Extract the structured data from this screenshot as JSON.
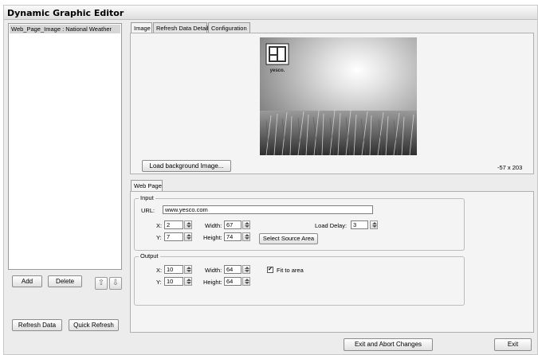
{
  "window": {
    "title": "Dynamic Graphic Editor"
  },
  "left_panel": {
    "list_items": [
      "Web_Page_Image : National Weather"
    ],
    "add_label": "Add",
    "delete_label": "Delete",
    "refresh_data_label": "Refresh Data",
    "quick_refresh_label": "Quick Refresh"
  },
  "tabs": [
    "Image",
    "Refresh Data Details",
    "Configuration"
  ],
  "image_tab": {
    "logo_text": "yesco.",
    "load_background_label": "Load background Image...",
    "image_size": "-57 x 203"
  },
  "web_page": {
    "tab_label": "Web Page",
    "input": {
      "group_label": "Input",
      "url_label": "URL:",
      "url_value": "www.yesco.com",
      "x_label": "X:",
      "x_value": "2",
      "y_label": "Y:",
      "y_value": "7",
      "width_label": "Width:",
      "width_value": "67",
      "height_label": "Height:",
      "height_value": "74",
      "load_delay_label": "Load Delay:",
      "load_delay_value": "3",
      "select_source_label": "Select Source Area"
    },
    "output": {
      "group_label": "Output",
      "x_label": "X:",
      "x_value": "10",
      "y_label": "Y:",
      "y_value": "10",
      "width_label": "Width:",
      "width_value": "64",
      "height_label": "Height:",
      "height_value": "64",
      "fit_to_area_label": "Fit to area",
      "fit_to_area_checked": true,
      "check_mark": "✔"
    }
  },
  "footer": {
    "exit_abort_label": "Exit and Abort Changes",
    "exit_label": "Exit"
  },
  "icons": {
    "move_up": "move-up-arrow-icon",
    "move_down": "move-down-arrow-icon"
  }
}
